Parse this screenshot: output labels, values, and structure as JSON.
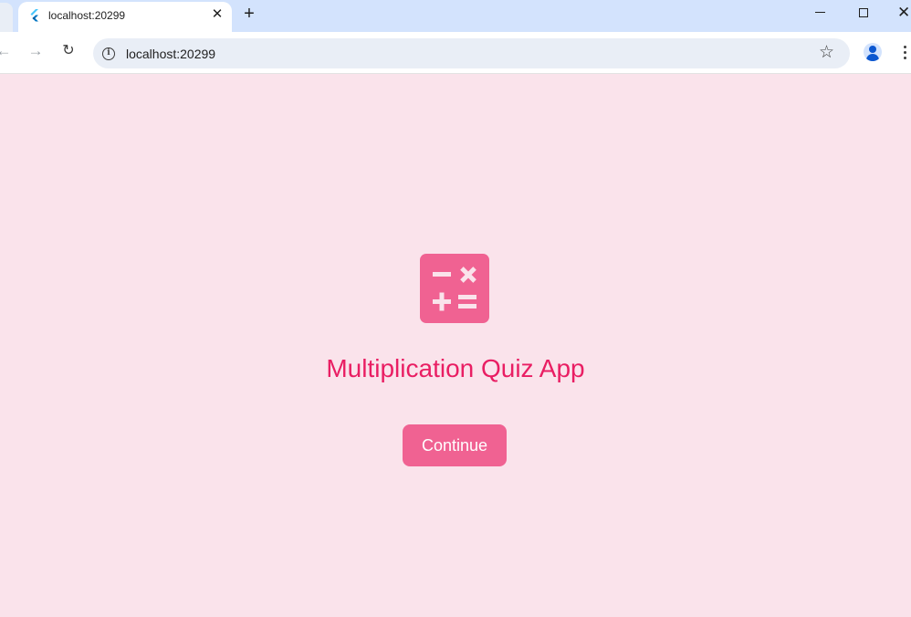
{
  "browser": {
    "tab": {
      "title": "localhost:20299",
      "favicon": "flutter-icon",
      "close_glyph": "✕"
    },
    "new_tab_glyph": "+",
    "toolbar": {
      "url": "localhost:20299",
      "back_glyph": "←",
      "forward_glyph": "→",
      "reload_glyph": "↻",
      "star_glyph": "☆"
    },
    "window_close_glyph": "✕"
  },
  "app": {
    "icon": "calculate-icon",
    "title": "Multiplication Quiz App",
    "continue_label": "Continue",
    "colors": {
      "background": "#fae3eb",
      "accent": "#f06292",
      "title": "#e91e63"
    }
  }
}
